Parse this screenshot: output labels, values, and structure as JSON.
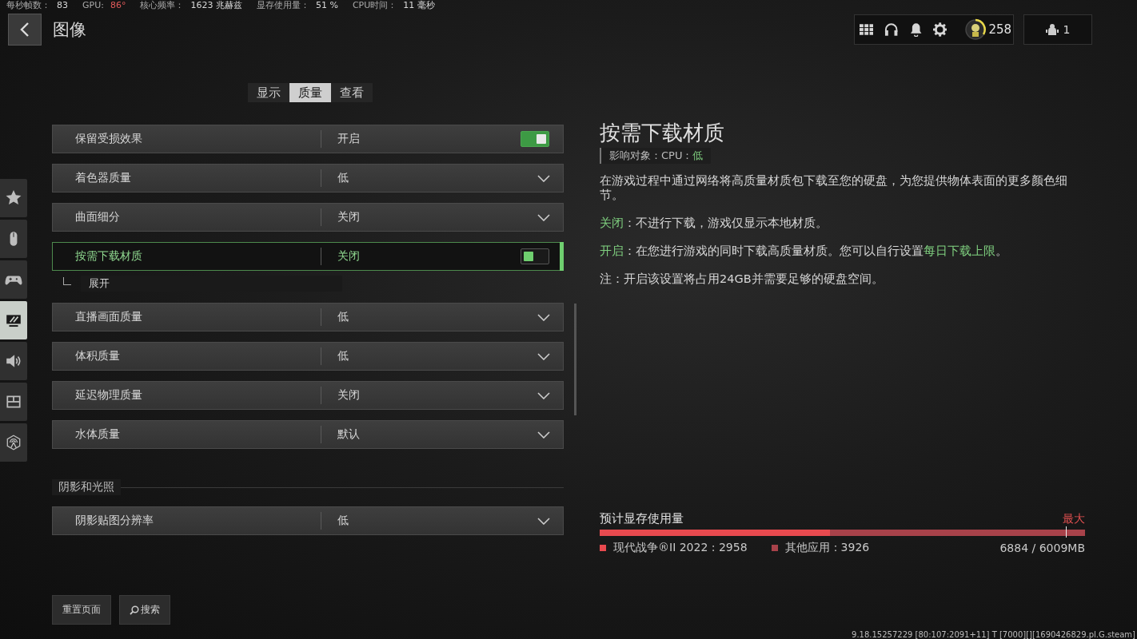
{
  "stats": [
    {
      "label": "每秒帧数：",
      "value": "83",
      "color": "#d8d8d8"
    },
    {
      "label": "GPU:",
      "value": "86°",
      "color": "#e05a5a"
    },
    {
      "label": "核心频率：",
      "value": "1623 兆赫兹",
      "color": "#d8d8d8"
    },
    {
      "label": "显存使用量：",
      "value": "51 %",
      "color": "#d8d8d8"
    },
    {
      "label": "CPU时间：",
      "value": "11 毫秒",
      "color": "#d8d8d8"
    }
  ],
  "header": {
    "title": "图像",
    "points": "258",
    "friends": "1"
  },
  "sidebar": {
    "items": [
      {
        "selected": false
      },
      {
        "selected": false
      },
      {
        "selected": false
      },
      {
        "selected": true
      },
      {
        "selected": false
      },
      {
        "selected": false
      },
      {
        "selected": false
      }
    ]
  },
  "tabs": [
    {
      "label": "显示",
      "selected": false
    },
    {
      "label": "质量",
      "selected": true
    },
    {
      "label": "查看",
      "selected": false
    }
  ],
  "settings": [
    {
      "kind": "toggle",
      "label": "保留受损效果",
      "value": "开启",
      "on": true,
      "selected": false
    },
    {
      "kind": "dropdown",
      "label": "着色器质量",
      "value": "低",
      "selected": false
    },
    {
      "kind": "dropdown",
      "label": "曲面细分",
      "value": "关闭",
      "selected": false
    },
    {
      "kind": "toggle",
      "label": "按需下载材质",
      "value": "关闭",
      "on": false,
      "selected": true
    },
    {
      "kind": "sub",
      "label": "展开"
    },
    {
      "kind": "dropdown",
      "label": "直播画面质量",
      "value": "低",
      "selected": false
    },
    {
      "kind": "dropdown",
      "label": "体积质量",
      "value": "低",
      "selected": false
    },
    {
      "kind": "dropdown",
      "label": "延迟物理质量",
      "value": "关闭",
      "selected": false
    },
    {
      "kind": "dropdown",
      "label": "水体质量",
      "value": "默认",
      "selected": false
    },
    {
      "kind": "section",
      "label": "阴影和光照"
    },
    {
      "kind": "dropdown",
      "label": "阴影贴图分辨率",
      "value": "低",
      "selected": false
    }
  ],
  "detail": {
    "title": "按需下载材质",
    "impact_label": "影响对象：CPU：",
    "impact_value": "低",
    "paragraphs": [
      [
        {
          "kind": "plain",
          "text": "在游戏过程中通过网络将高质量材质包下载至您的硬盘，为您提供物体表面的更多颜色细节。"
        }
      ],
      [
        {
          "kind": "accent",
          "text": "关闭"
        },
        {
          "kind": "plain",
          "text": "：不进行下载，游戏仅显示本地材质。"
        }
      ],
      [
        {
          "kind": "accent",
          "text": "开启"
        },
        {
          "kind": "plain",
          "text": "：在您进行游戏的同时下载高质量材质。您可以自行设置"
        },
        {
          "kind": "link",
          "text": "每日下载上限"
        },
        {
          "kind": "plain",
          "text": "。"
        }
      ],
      [
        {
          "kind": "plain",
          "text": "注：开启该设置将占用24GB并需要足够的硬盘空间。"
        }
      ]
    ]
  },
  "memory": {
    "title": "预计显存使用量",
    "max": {
      "label": "最大",
      "level": 0.96
    },
    "segments": [
      {
        "label": "现代战争®II 2022 : 2958",
        "level": 0.475,
        "color": "#e84a4f"
      },
      {
        "label": "其他应用：3926",
        "level": 0.525,
        "color": "#a8424a"
      }
    ],
    "total": "6884 / 6009MB"
  },
  "footer": {
    "buttons": [
      {
        "label": "重置页面",
        "kind": "plain"
      },
      {
        "label": "搜索",
        "kind": "search"
      }
    ],
    "version": "9.18.15257229 [80:107:2091+11] T [7000][][1690426829.pl.G.steam]"
  }
}
